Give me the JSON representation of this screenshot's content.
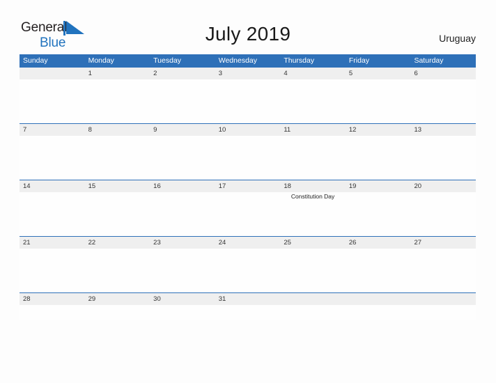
{
  "brand": {
    "name_part1": "General",
    "name_part2": "Blue",
    "flag_icon": "blue-triangle-flag-icon",
    "colors": {
      "text": "#231F20",
      "accent": "#2173BE"
    }
  },
  "header": {
    "title": "July 2019",
    "country": "Uruguay"
  },
  "theme": {
    "header_blue": "#2E70B8",
    "band_gray": "#EFEFEF",
    "page_background": "#FDFDFD",
    "rule_blue": "#2E70B8"
  },
  "calendar": {
    "month": "July",
    "year": "2019",
    "weekday_headers": [
      "Sunday",
      "Monday",
      "Tuesday",
      "Wednesday",
      "Thursday",
      "Friday",
      "Saturday"
    ],
    "weeks": [
      {
        "days": [
          {
            "number": "",
            "event": ""
          },
          {
            "number": "1",
            "event": ""
          },
          {
            "number": "2",
            "event": ""
          },
          {
            "number": "3",
            "event": ""
          },
          {
            "number": "4",
            "event": ""
          },
          {
            "number": "5",
            "event": ""
          },
          {
            "number": "6",
            "event": ""
          }
        ]
      },
      {
        "days": [
          {
            "number": "7",
            "event": ""
          },
          {
            "number": "8",
            "event": ""
          },
          {
            "number": "9",
            "event": ""
          },
          {
            "number": "10",
            "event": ""
          },
          {
            "number": "11",
            "event": ""
          },
          {
            "number": "12",
            "event": ""
          },
          {
            "number": "13",
            "event": ""
          }
        ]
      },
      {
        "days": [
          {
            "number": "14",
            "event": ""
          },
          {
            "number": "15",
            "event": ""
          },
          {
            "number": "16",
            "event": ""
          },
          {
            "number": "17",
            "event": ""
          },
          {
            "number": "18",
            "event": "Constitution Day"
          },
          {
            "number": "19",
            "event": ""
          },
          {
            "number": "20",
            "event": ""
          }
        ]
      },
      {
        "days": [
          {
            "number": "21",
            "event": ""
          },
          {
            "number": "22",
            "event": ""
          },
          {
            "number": "23",
            "event": ""
          },
          {
            "number": "24",
            "event": ""
          },
          {
            "number": "25",
            "event": ""
          },
          {
            "number": "26",
            "event": ""
          },
          {
            "number": "27",
            "event": ""
          }
        ]
      },
      {
        "days": [
          {
            "number": "28",
            "event": ""
          },
          {
            "number": "29",
            "event": ""
          },
          {
            "number": "30",
            "event": ""
          },
          {
            "number": "31",
            "event": ""
          },
          {
            "number": "",
            "event": ""
          },
          {
            "number": "",
            "event": ""
          },
          {
            "number": "",
            "event": ""
          }
        ]
      }
    ]
  }
}
